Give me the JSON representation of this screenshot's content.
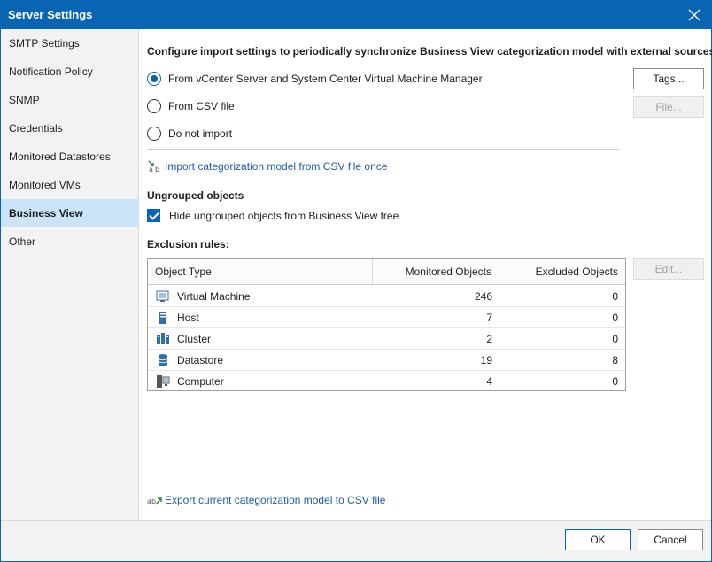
{
  "window": {
    "title": "Server Settings",
    "accent_color": "#0a64b4",
    "close_icon": "close-icon"
  },
  "sidebar": {
    "items": [
      {
        "label": "SMTP Settings",
        "active": false
      },
      {
        "label": "Notification Policy",
        "active": false
      },
      {
        "label": "SNMP",
        "active": false
      },
      {
        "label": "Credentials",
        "active": false
      },
      {
        "label": "Monitored Datastores",
        "active": false
      },
      {
        "label": "Monitored VMs",
        "active": false
      },
      {
        "label": "Business View",
        "active": true
      },
      {
        "label": "Other",
        "active": false
      }
    ]
  },
  "main": {
    "heading": "Configure import settings to periodically synchronize Business View categorization model with external sources",
    "import_options": [
      {
        "label": "From vCenter Server and System Center Virtual Machine Manager",
        "selected": true
      },
      {
        "label": "From CSV file",
        "selected": false
      },
      {
        "label": "Do not import",
        "selected": false
      }
    ],
    "tags_button": "Tags...",
    "file_button": "File...",
    "import_link": "Import categorization model from CSV file once",
    "ungrouped_heading": "Ungrouped objects",
    "hide_ungrouped_label": "Hide ungrouped objects from Business View tree",
    "hide_ungrouped_checked": true,
    "exclusion_heading": "Exclusion rules:",
    "edit_button": "Edit...",
    "export_link": "Export current categorization model to CSV file"
  },
  "table": {
    "columns": [
      "Object Type",
      "Monitored Objects",
      "Excluded Objects"
    ],
    "rows": [
      {
        "icon": "virtual-machine-icon",
        "type": "Virtual Machine",
        "monitored": "246",
        "excluded": "0"
      },
      {
        "icon": "host-icon",
        "type": "Host",
        "monitored": "7",
        "excluded": "0"
      },
      {
        "icon": "cluster-icon",
        "type": "Cluster",
        "monitored": "2",
        "excluded": "0"
      },
      {
        "icon": "datastore-icon",
        "type": "Datastore",
        "monitored": "19",
        "excluded": "8"
      },
      {
        "icon": "computer-icon",
        "type": "Computer",
        "monitored": "4",
        "excluded": "0"
      }
    ]
  },
  "footer": {
    "ok_label": "OK",
    "cancel_label": "Cancel"
  }
}
